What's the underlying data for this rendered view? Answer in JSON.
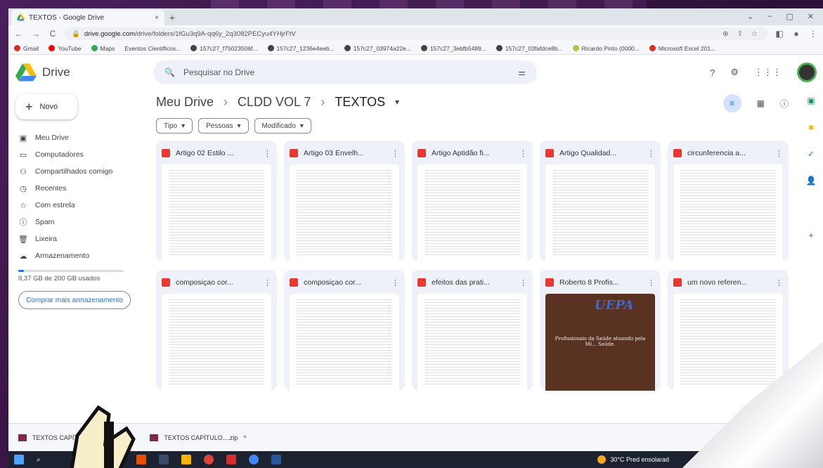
{
  "browser": {
    "tab_title": "TEXTOS - Google Drive",
    "tab_close": "×",
    "new_tab": "+",
    "url_host": "drive.google.com",
    "url_path": "/drive/folders/1fGu3q9A-qq6y_2q3082PECyu4YHjrFtV",
    "bookmarks": [
      {
        "label": "Gmail",
        "color": "#d93025"
      },
      {
        "label": "YouTube",
        "color": "#ff0000"
      },
      {
        "label": "Maps",
        "color": "#34a853"
      },
      {
        "label": "Eventos Científicos...",
        "color": ""
      },
      {
        "label": "157c27_f75023506f...",
        "color": "#444444"
      },
      {
        "label": "157c27_1236e4eeb...",
        "color": "#444444"
      },
      {
        "label": "157c27_03974a22e...",
        "color": "#444444"
      },
      {
        "label": "157c27_3ebfb5489...",
        "color": "#444444"
      },
      {
        "label": "157c27_03fafdce8b...",
        "color": "#444444"
      },
      {
        "label": "Ricardo Pinto (0000...",
        "color": "#a6ce39"
      },
      {
        "label": "Microsoft Excel 201...",
        "color": "#d93025"
      }
    ]
  },
  "drive": {
    "app_name": "Drive",
    "search_placeholder": "Pesquisar no Drive",
    "new_label": "Novo",
    "nav": [
      {
        "label": "Meu Drive",
        "icon": "drive-icon",
        "glyph": "▣"
      },
      {
        "label": "Computadores",
        "icon": "computer-icon",
        "glyph": "▭"
      },
      {
        "label": "Compartilhados comigo",
        "icon": "shared-icon",
        "glyph": "⚇"
      },
      {
        "label": "Recentes",
        "icon": "clock-icon",
        "glyph": "◷"
      },
      {
        "label": "Com estrela",
        "icon": "star-icon",
        "glyph": "☆"
      },
      {
        "label": "Spam",
        "icon": "spam-icon",
        "glyph": "ⓘ"
      },
      {
        "label": "Lixeira",
        "icon": "trash-icon",
        "glyph": "🗑"
      },
      {
        "label": "Armazenamento",
        "icon": "cloud-icon",
        "glyph": "☁"
      }
    ],
    "storage_used_fraction": 0.05,
    "storage_text": "9,37 GB de 200 GB usados",
    "buy_storage": "Comprar mais armazenamento",
    "breadcrumb": [
      "Meu Drive",
      "CLDD VOL 7",
      "TEXTOS"
    ],
    "breadcrumb_sep": "›",
    "filters": [
      "Tipo",
      "Pessoas",
      "Modificado"
    ],
    "files": [
      {
        "name": "Artigo 02 Estilo ...",
        "thumb": "doc"
      },
      {
        "name": "Artigo 03 Envelh...",
        "thumb": "doc"
      },
      {
        "name": "Artigo Aptidão fi...",
        "thumb": "doc"
      },
      {
        "name": "Artigo Qualidad...",
        "thumb": "doc"
      },
      {
        "name": "circunferencia a...",
        "thumb": "doc"
      },
      {
        "name": "composiçao cor...",
        "thumb": "doc"
      },
      {
        "name": "composiçao cor...",
        "thumb": "doc"
      },
      {
        "name": "efeitos das prati...",
        "thumb": "doc"
      },
      {
        "name": "Roberto 8 Profis...",
        "thumb": "dark"
      },
      {
        "name": "um novo referen...",
        "thumb": "doc"
      }
    ],
    "uepa_logo": "UEPA",
    "uepa_caption": "Profissionais da Saúde atuando pela Mi... Saúde."
  },
  "downloads": [
    {
      "label": "TEXTOS CAPÍT..."
    },
    {
      "label": "TEXTOS CAPÍTULO....zip"
    }
  ],
  "download_chevron": "^",
  "taskbar": {
    "weather": "30°C  Pred ensolarad"
  },
  "colors": {
    "accent": "#1a73e8",
    "pdf": "#e53935"
  }
}
